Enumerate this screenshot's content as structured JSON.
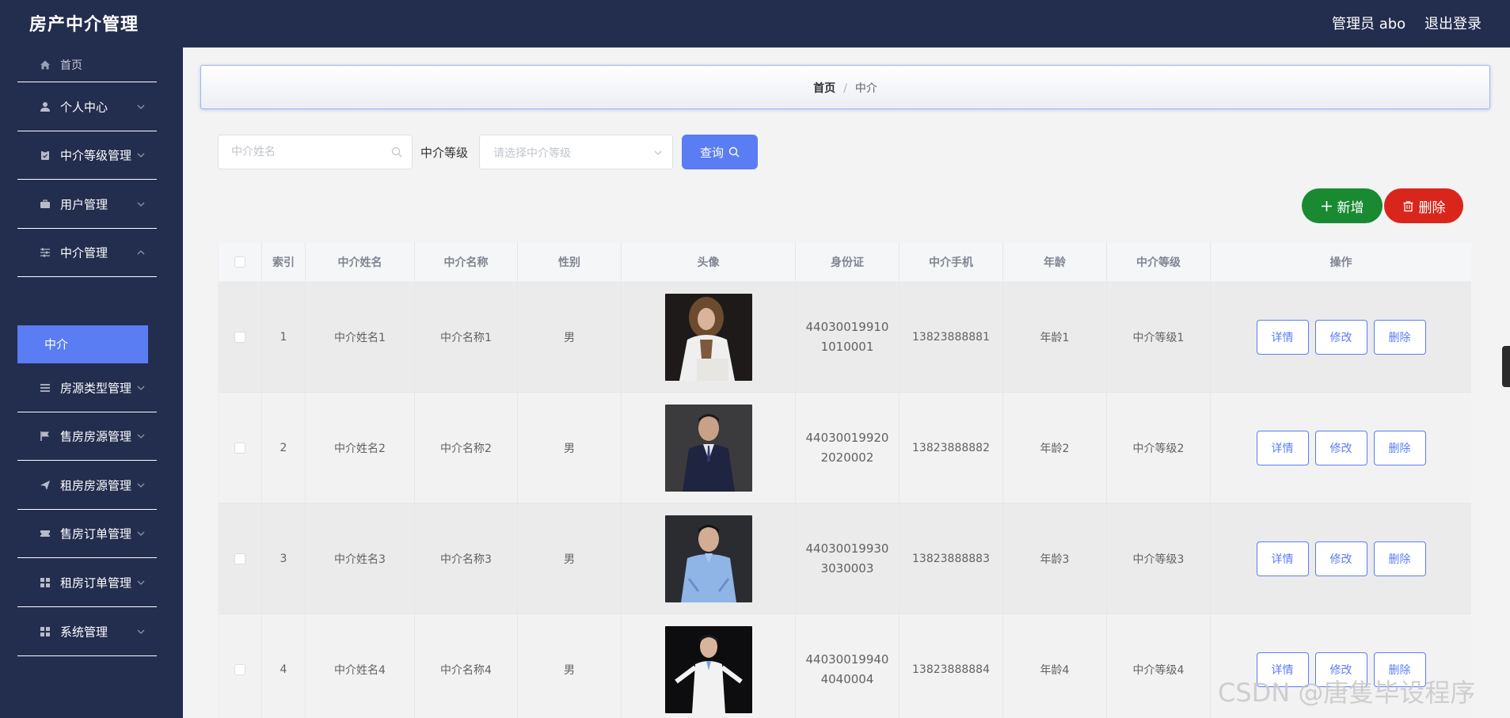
{
  "header": {
    "brand": "房产中介管理",
    "admin": "管理员 abo",
    "logout": "退出登录"
  },
  "sidebar": {
    "items": [
      {
        "label": "首页",
        "icon": "home-icon"
      },
      {
        "label": "个人中心",
        "icon": "user-icon"
      },
      {
        "label": "中介等级管理",
        "icon": "clipboard-icon"
      },
      {
        "label": "用户管理",
        "icon": "briefcase-icon"
      },
      {
        "label": "中介管理",
        "icon": "sliders-icon"
      },
      {
        "label": "房源类型管理",
        "icon": "list-icon"
      },
      {
        "label": "售房房源管理",
        "icon": "flag-icon"
      },
      {
        "label": "租房房源管理",
        "icon": "send-icon"
      },
      {
        "label": "售房订单管理",
        "icon": "ticket-icon"
      },
      {
        "label": "租房订单管理",
        "icon": "grid-icon"
      },
      {
        "label": "系统管理",
        "icon": "grid-icon"
      }
    ],
    "active_sub": "中介"
  },
  "breadcrumb": {
    "home": "首页",
    "separator": "/",
    "current": "中介"
  },
  "search": {
    "name_placeholder": "中介姓名",
    "level_label": "中介等级",
    "level_placeholder": "请选择中介等级",
    "query_label": "查询"
  },
  "actions": {
    "add_label": "新增",
    "delete_label": "删除"
  },
  "table": {
    "columns": [
      "索引",
      "中介姓名",
      "中介名称",
      "性别",
      "头像",
      "身份证",
      "中介手机",
      "年龄",
      "中介等级",
      "操作"
    ],
    "rows": [
      {
        "index": "1",
        "name": "中介姓名1",
        "title": "中介名称1",
        "gender": "男",
        "id_line1": "44030019910",
        "id_line2": "1010001",
        "phone": "13823888881",
        "age": "年龄1",
        "level": "中介等级1"
      },
      {
        "index": "2",
        "name": "中介姓名2",
        "title": "中介名称2",
        "gender": "男",
        "id_line1": "44030019920",
        "id_line2": "2020002",
        "phone": "13823888882",
        "age": "年龄2",
        "level": "中介等级2"
      },
      {
        "index": "3",
        "name": "中介姓名3",
        "title": "中介名称3",
        "gender": "男",
        "id_line1": "44030019930",
        "id_line2": "3030003",
        "phone": "13823888883",
        "age": "年龄3",
        "level": "中介等级3"
      },
      {
        "index": "4",
        "name": "中介姓名4",
        "title": "中介名称4",
        "gender": "男",
        "id_line1": "44030019940",
        "id_line2": "4040004",
        "phone": "13823888884",
        "age": "年龄4",
        "level": "中介等级4"
      }
    ],
    "row_buttons": {
      "detail": "详情",
      "edit": "修改",
      "delete": "删除"
    }
  },
  "watermark": "CSDN @唐隻毕设程序",
  "colors": {
    "sidebar_bg": "#232d4e",
    "accent": "#5a7df3",
    "add_green": "#1a8a32",
    "delete_red": "#d9261c"
  }
}
